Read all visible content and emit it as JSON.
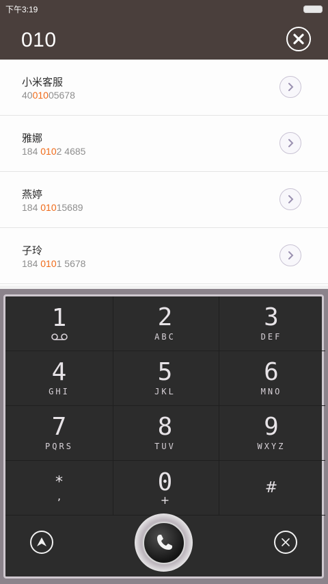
{
  "status_bar": {
    "time": "下午3:19"
  },
  "dial": {
    "input": "010"
  },
  "contacts": [
    {
      "name": "小米客服",
      "number_pre": "40",
      "number_hl": "010",
      "number_post": "05678"
    },
    {
      "name": "雅娜",
      "number_pre": "184 ",
      "number_hl": "010",
      "number_post": "2 4685"
    },
    {
      "name": "燕婷",
      "number_pre": "184 ",
      "number_hl": "010",
      "number_post": "15689"
    },
    {
      "name": "子玲",
      "number_pre": "184 ",
      "number_hl": "010",
      "number_post": "1 5678"
    }
  ],
  "keypad": [
    {
      "digit": "1",
      "letters": ""
    },
    {
      "digit": "2",
      "letters": "ABC"
    },
    {
      "digit": "3",
      "letters": "DEF"
    },
    {
      "digit": "4",
      "letters": "GHI"
    },
    {
      "digit": "5",
      "letters": "JKL"
    },
    {
      "digit": "6",
      "letters": "MNO"
    },
    {
      "digit": "7",
      "letters": "PQRS"
    },
    {
      "digit": "8",
      "letters": "TUV"
    },
    {
      "digit": "9",
      "letters": "WXYZ"
    },
    {
      "digit": "*",
      "letters": ","
    },
    {
      "digit": "0",
      "letters": "+"
    },
    {
      "digit": "#",
      "letters": ""
    }
  ],
  "colors": {
    "header": "#4a3f3c",
    "highlight": "#f06a18",
    "keypad_bg": "#2c2c2c"
  },
  "icons": {
    "clear": "close-circle-icon",
    "detail": "chevron-right-icon",
    "voicemail": "voicemail-icon",
    "nav": "navigation-arrow-icon",
    "call": "phone-icon",
    "delete": "delete-x-icon"
  }
}
